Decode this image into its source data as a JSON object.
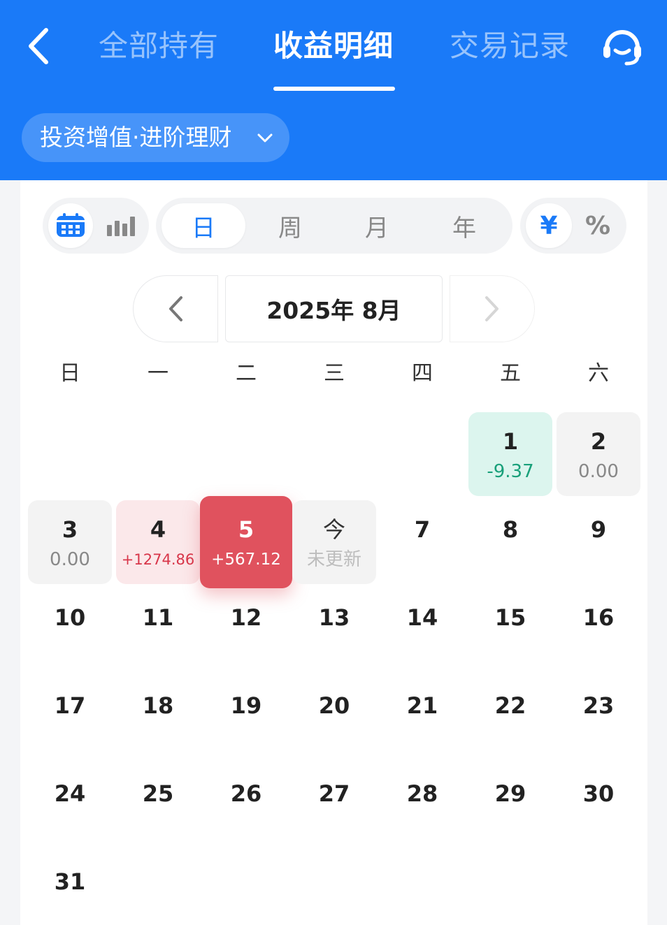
{
  "header": {
    "tabs": [
      {
        "label": "全部持有",
        "active": false
      },
      {
        "label": "收益明细",
        "active": true
      },
      {
        "label": "交易记录",
        "active": false
      }
    ],
    "back_icon": "chevron-left-icon",
    "service_icon": "headset-icon",
    "accent_color": "#1a7af8"
  },
  "product": {
    "label": "投资增值·进阶理财",
    "icon": "chevron-down-icon"
  },
  "view_toggle": {
    "calendar_icon": "calendar-icon",
    "bar_icon": "bar-chart-icon",
    "selected": "calendar"
  },
  "periods": [
    {
      "label": "日",
      "selected": true
    },
    {
      "label": "周",
      "selected": false
    },
    {
      "label": "月",
      "selected": false
    },
    {
      "label": "年",
      "selected": false
    }
  ],
  "units": [
    {
      "label": "¥",
      "selected": true
    },
    {
      "label": "%",
      "selected": false
    }
  ],
  "month_nav": {
    "label": "2025年 8月",
    "prev_icon": "chevron-left-icon",
    "next_icon": "chevron-right-icon"
  },
  "weekdays": [
    "日",
    "一",
    "二",
    "三",
    "四",
    "五",
    "六"
  ],
  "calendar": {
    "first_weekday": 5,
    "days": [
      {
        "day": "1",
        "value": "-9.37",
        "state": "loss"
      },
      {
        "day": "2",
        "value": "0.00",
        "state": "flat"
      },
      {
        "day": "3",
        "value": "0.00",
        "state": "flat"
      },
      {
        "day": "4",
        "value": "+1274.86",
        "state": "gain"
      },
      {
        "day": "5",
        "value": "+567.12",
        "state": "selected"
      },
      {
        "day": "今",
        "value": "未更新",
        "state": "today"
      },
      {
        "day": "7"
      },
      {
        "day": "8"
      },
      {
        "day": "9"
      },
      {
        "day": "10"
      },
      {
        "day": "11"
      },
      {
        "day": "12"
      },
      {
        "day": "13"
      },
      {
        "day": "14"
      },
      {
        "day": "15"
      },
      {
        "day": "16"
      },
      {
        "day": "17"
      },
      {
        "day": "18"
      },
      {
        "day": "19"
      },
      {
        "day": "20"
      },
      {
        "day": "21"
      },
      {
        "day": "22"
      },
      {
        "day": "23"
      },
      {
        "day": "24"
      },
      {
        "day": "25"
      },
      {
        "day": "26"
      },
      {
        "day": "27"
      },
      {
        "day": "28"
      },
      {
        "day": "29"
      },
      {
        "day": "30"
      },
      {
        "day": "31"
      }
    ],
    "colors": {
      "loss": "#19a07a",
      "gain": "#d8364a",
      "selected": "#e0525e"
    }
  }
}
